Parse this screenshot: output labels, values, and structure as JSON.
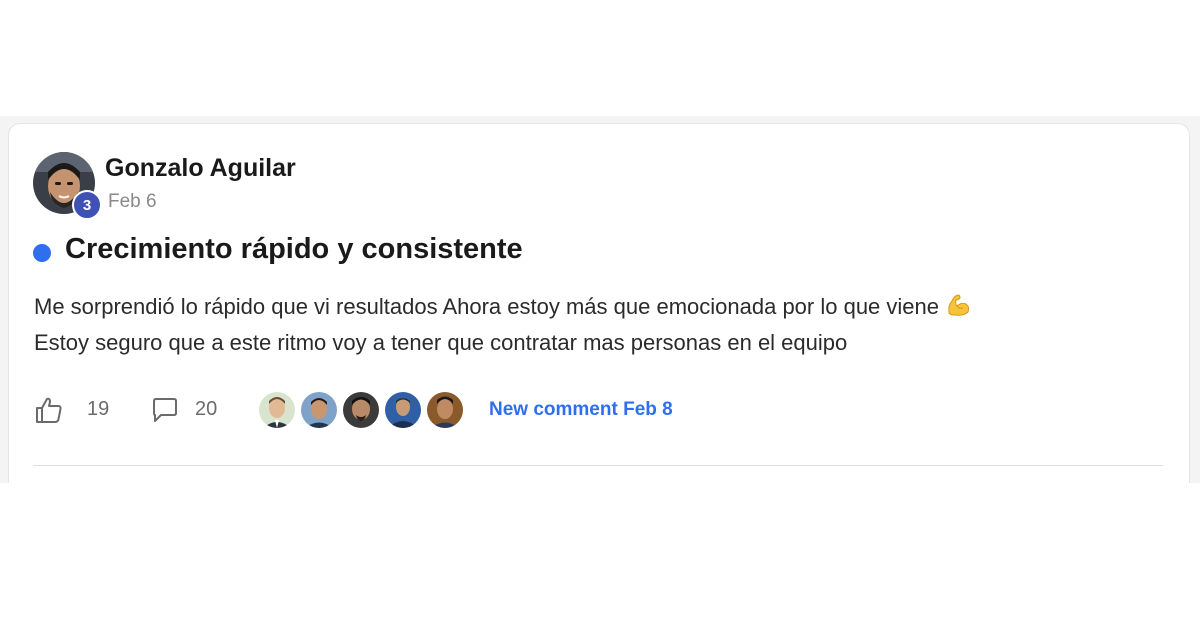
{
  "post": {
    "author": "Gonzalo Aguilar",
    "level": "3",
    "date": "Feb 6",
    "title": "Crecimiento rápido y consistente",
    "body_line1": "Me sorprendió lo rápido que vi resultados Ahora estoy más que emocionada por lo que viene",
    "body_line1_emoji": "flexed-biceps-emoji",
    "body_line2": "Estoy seguro que a este ritmo voy a tener que contratar mas personas en el equipo",
    "likes": "19",
    "comments": "20",
    "commenter_avatars": [
      "avatar-1",
      "avatar-2",
      "avatar-3",
      "avatar-4",
      "avatar-5"
    ],
    "new_comment": "New comment Feb 8"
  },
  "icons": {
    "like": "thumbs-up-icon",
    "comment": "comment-bubble-icon"
  },
  "colors": {
    "accent": "#2f6fed",
    "level_badge": "#3f51b5",
    "title_dot": "#2f6fed"
  }
}
